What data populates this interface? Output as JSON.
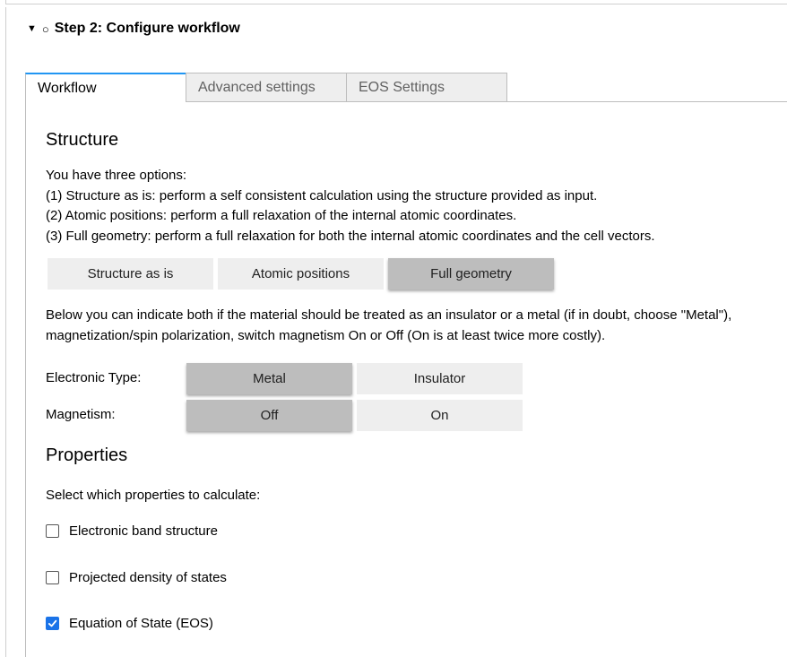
{
  "step": {
    "toggle_glyph": "▼",
    "status_glyph": "○",
    "title": "Step 2: Configure workflow"
  },
  "tabs": [
    {
      "label": "Workflow",
      "active": true
    },
    {
      "label": "Advanced settings",
      "active": false
    },
    {
      "label": "EOS Settings",
      "active": false
    }
  ],
  "structure": {
    "heading": "Structure",
    "intro_lines": [
      "You have three options:",
      "(1) Structure as is: perform a self consistent calculation using the structure provided as input.",
      "(2) Atomic positions: perform a full relaxation of the internal atomic coordinates.",
      "(3) Full geometry: perform a full relaxation for both the internal atomic coordinates and the cell vectors."
    ],
    "options": [
      "Structure as is",
      "Atomic positions",
      "Full geometry"
    ],
    "selected": "Full geometry",
    "note_lines": [
      "Below you can indicate both if the material should be treated as an insulator or a metal (if in doubt, choose \"Metal\"),",
      "magnetization/spin polarization, switch magnetism On or Off (On is at least twice more costly)."
    ]
  },
  "electronic_type": {
    "label": "Electronic Type:",
    "options": [
      "Metal",
      "Insulator"
    ],
    "selected": "Metal"
  },
  "magnetism": {
    "label": "Magnetism:",
    "options": [
      "Off",
      "On"
    ],
    "selected": "Off"
  },
  "properties": {
    "heading": "Properties",
    "prompt": "Select which properties to calculate:",
    "items": [
      {
        "label": "Electronic band structure",
        "checked": false
      },
      {
        "label": "Projected density of states",
        "checked": false
      },
      {
        "label": "Equation of State (EOS)",
        "checked": true
      }
    ]
  },
  "colors": {
    "accent": "#2196f3",
    "checkbox": "#1a73e8",
    "selected_button": "#bdbdbd",
    "button": "#eeeeee"
  }
}
